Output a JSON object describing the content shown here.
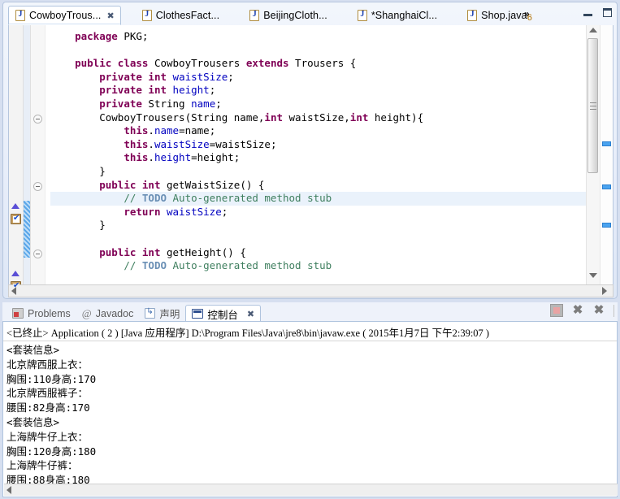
{
  "editor": {
    "tabs": [
      {
        "label": "CowboyTrous...",
        "icon": "java-file-icon",
        "active": true,
        "dirty": false,
        "closable": true
      },
      {
        "label": "ClothesFact...",
        "icon": "java-file-icon",
        "active": false,
        "dirty": false,
        "closable": false
      },
      {
        "label": "BeijingCloth...",
        "icon": "java-file-icon",
        "active": false,
        "dirty": false,
        "closable": false
      },
      {
        "label": "*ShanghaiCl...",
        "icon": "java-file-icon",
        "active": false,
        "dirty": true,
        "closable": false
      },
      {
        "label": "Shop.java",
        "icon": "java-file-icon",
        "active": false,
        "dirty": false,
        "closable": false
      }
    ],
    "overflow": {
      "chevron": "»",
      "count": "6"
    },
    "window_controls": {
      "minimize": "minimize-icon",
      "maximize": "maximize-icon"
    },
    "close_glyph": "✖",
    "code_lines": [
      {
        "indent": 1,
        "tokens": [
          {
            "t": "kw",
            "v": "package"
          },
          {
            "t": "pln",
            "v": " PKG;"
          }
        ]
      },
      {
        "indent": 0,
        "tokens": []
      },
      {
        "indent": 1,
        "tokens": [
          {
            "t": "kw",
            "v": "public class"
          },
          {
            "t": "pln",
            "v": " CowboyTrousers "
          },
          {
            "t": "kw",
            "v": "extends"
          },
          {
            "t": "pln",
            "v": " Trousers {"
          }
        ]
      },
      {
        "indent": 2,
        "tokens": [
          {
            "t": "kw",
            "v": "private int"
          },
          {
            "t": "fld",
            "v": " waistSize"
          },
          {
            "t": "pln",
            "v": ";"
          }
        ]
      },
      {
        "indent": 2,
        "tokens": [
          {
            "t": "kw",
            "v": "private int"
          },
          {
            "t": "fld",
            "v": " height"
          },
          {
            "t": "pln",
            "v": ";"
          }
        ]
      },
      {
        "indent": 2,
        "tokens": [
          {
            "t": "kw",
            "v": "private"
          },
          {
            "t": "pln",
            "v": " String "
          },
          {
            "t": "fld",
            "v": "name"
          },
          {
            "t": "pln",
            "v": ";"
          }
        ]
      },
      {
        "indent": 2,
        "tokens": [
          {
            "t": "pln",
            "v": "CowboyTrousers(String name,"
          },
          {
            "t": "kw",
            "v": "int"
          },
          {
            "t": "pln",
            "v": " waistSize,"
          },
          {
            "t": "kw",
            "v": "int"
          },
          {
            "t": "pln",
            "v": " height){"
          }
        ]
      },
      {
        "indent": 3,
        "tokens": [
          {
            "t": "kw",
            "v": "this"
          },
          {
            "t": "pln",
            "v": "."
          },
          {
            "t": "fld",
            "v": "name"
          },
          {
            "t": "pln",
            "v": "=name;"
          }
        ]
      },
      {
        "indent": 3,
        "tokens": [
          {
            "t": "kw",
            "v": "this"
          },
          {
            "t": "pln",
            "v": "."
          },
          {
            "t": "fld",
            "v": "waistSize"
          },
          {
            "t": "pln",
            "v": "=waistSize;"
          }
        ]
      },
      {
        "indent": 3,
        "tokens": [
          {
            "t": "kw",
            "v": "this"
          },
          {
            "t": "pln",
            "v": "."
          },
          {
            "t": "fld",
            "v": "height"
          },
          {
            "t": "pln",
            "v": "=height;"
          }
        ]
      },
      {
        "indent": 2,
        "tokens": [
          {
            "t": "pln",
            "v": "}"
          }
        ]
      },
      {
        "indent": 2,
        "tokens": [
          {
            "t": "kw",
            "v": "public int"
          },
          {
            "t": "pln",
            "v": " getWaistSize() {"
          }
        ]
      },
      {
        "indent": 3,
        "highlight": true,
        "tokens": [
          {
            "t": "cmt",
            "v": "// "
          },
          {
            "t": "todo",
            "v": "TODO"
          },
          {
            "t": "cmt",
            "v": " Auto-generated method stub"
          }
        ]
      },
      {
        "indent": 3,
        "tokens": [
          {
            "t": "kw",
            "v": "return"
          },
          {
            "t": "fld",
            "v": " waistSize"
          },
          {
            "t": "pln",
            "v": ";"
          }
        ]
      },
      {
        "indent": 2,
        "tokens": [
          {
            "t": "pln",
            "v": "}"
          }
        ]
      },
      {
        "indent": 0,
        "tokens": []
      },
      {
        "indent": 2,
        "tokens": [
          {
            "t": "kw",
            "v": "public int"
          },
          {
            "t": "pln",
            "v": " getHeight() {"
          }
        ]
      },
      {
        "indent": 3,
        "tokens": [
          {
            "t": "cmt",
            "v": "// "
          },
          {
            "t": "todo",
            "v": "TODO"
          },
          {
            "t": "cmt",
            "v": " Auto-generated method stub"
          }
        ]
      }
    ]
  },
  "console": {
    "tabs": [
      {
        "label": "Problems",
        "icon": "problems-icon",
        "active": false,
        "closable": false
      },
      {
        "label": "Javadoc",
        "icon": "javadoc-at-icon",
        "active": false,
        "closable": false
      },
      {
        "label": "声明",
        "icon": "declaration-icon",
        "active": false,
        "closable": false
      },
      {
        "label": "控制台",
        "icon": "console-icon",
        "active": true,
        "closable": true
      }
    ],
    "toolbar": [
      {
        "name": "terminate-button",
        "label": ""
      },
      {
        "name": "remove-launch-button",
        "label": "✖"
      },
      {
        "name": "remove-all-terminated-button",
        "label": "✖"
      }
    ],
    "close_glyph": "✖",
    "status_line": "<已终止> Application ( 2 ) [Java 应用程序] D:\\Program Files\\Java\\jre8\\bin\\javaw.exe ( 2015年1月7日 下午2:39:07 )",
    "output_lines": [
      "<套装信息>",
      "北京牌西服上衣：",
      "胸围:110身高:170",
      "北京牌西服裤子：",
      "腰围:82身高:170",
      "<套装信息>",
      "上海牌牛仔上衣：",
      "胸围:120身高:180",
      "上海牌牛仔裤：",
      "腰围:88身高:180"
    ]
  },
  "colors": {
    "keyword": "#7f0055",
    "comment": "#3f7f5f",
    "todo": "#6a8fb5",
    "field": "#0000c0",
    "highlight_line": "#eaf2fb",
    "marker_blue": "#4aa3ef",
    "frame_border": "#b6c6de",
    "chrome_bg": "#d6dff0"
  }
}
